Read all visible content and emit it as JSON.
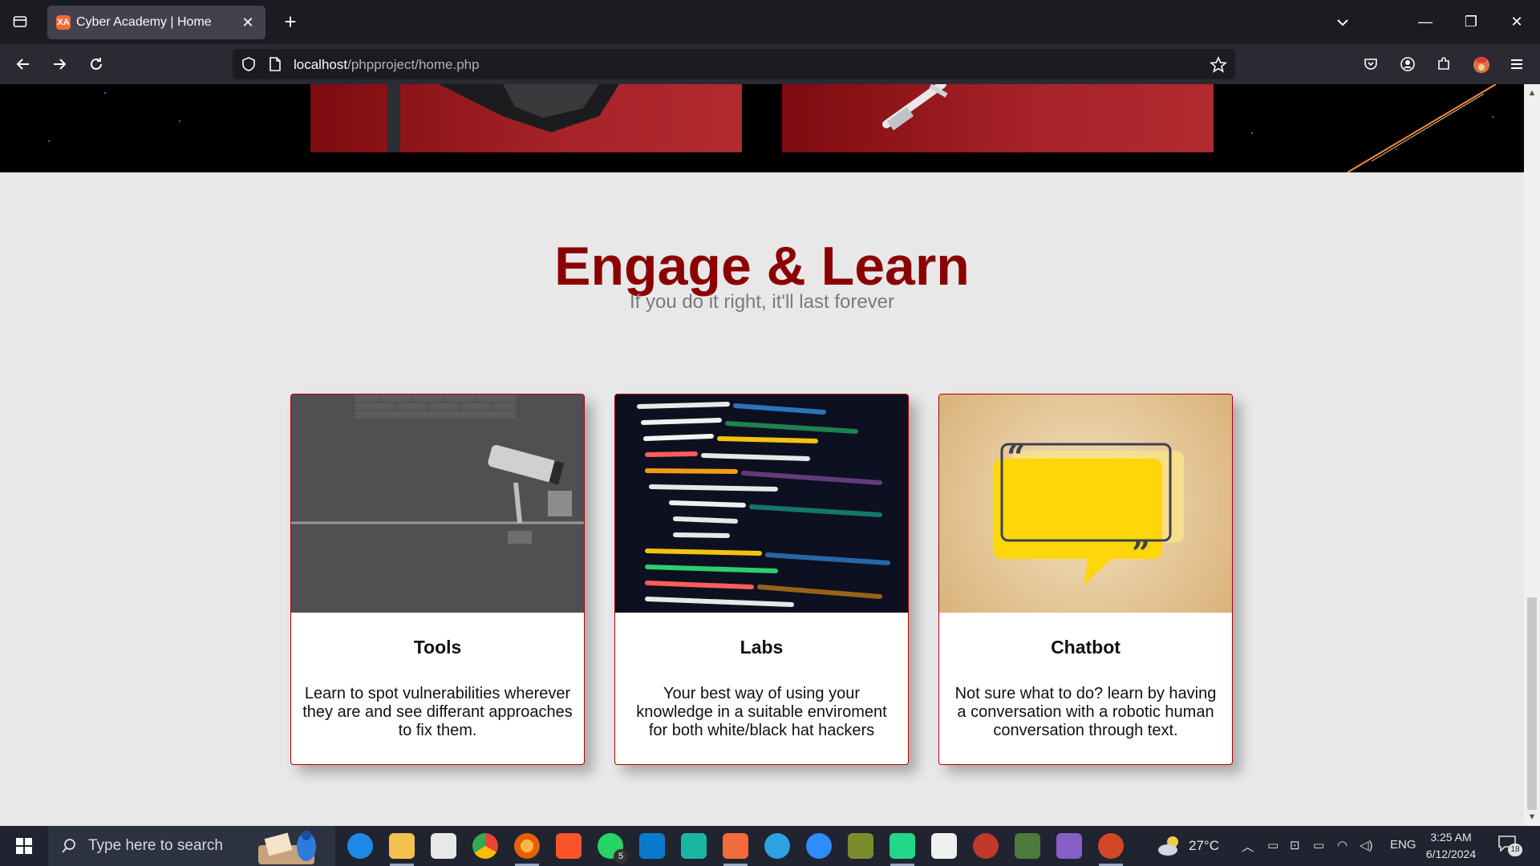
{
  "browser": {
    "tab_title": "Cyber Academy | Home",
    "tab_favicon_text": "XA",
    "new_tab_symbol": "+",
    "close_symbol": "✕",
    "url_host": "localhost",
    "url_path": "/phpproject/home.php"
  },
  "window_controls": {
    "minimize": "—",
    "restore": "❐",
    "close": "✕"
  },
  "section": {
    "title": "Engage & Learn",
    "subtitle": "If you do it right, it'll last forever"
  },
  "cards": [
    {
      "title": "Tools",
      "text": "Learn to spot vulnerabilities wherever they are and see differant approaches to fix them.",
      "image": "security-camera"
    },
    {
      "title": "Labs",
      "text": "Your best way of using your knowledge in a suitable enviroment for both white/black hat hackers",
      "image": "code-screen"
    },
    {
      "title": "Chatbot",
      "text": "Not sure what to do? learn by having a conversation with a robotic human conversation through text.",
      "image": "quote-bubble"
    }
  ],
  "taskbar": {
    "search_placeholder": "Type here to search",
    "temperature": "27°C",
    "language": "ENG",
    "time": "3:25 AM",
    "date": "6/12/2024",
    "notification_count": "18",
    "whatsapp_badge": "5"
  },
  "colors": {
    "title_red": "#8b0000",
    "card_border": "#b30000",
    "fab_blue": "#1877f2",
    "hero_red": "#a8232a"
  }
}
